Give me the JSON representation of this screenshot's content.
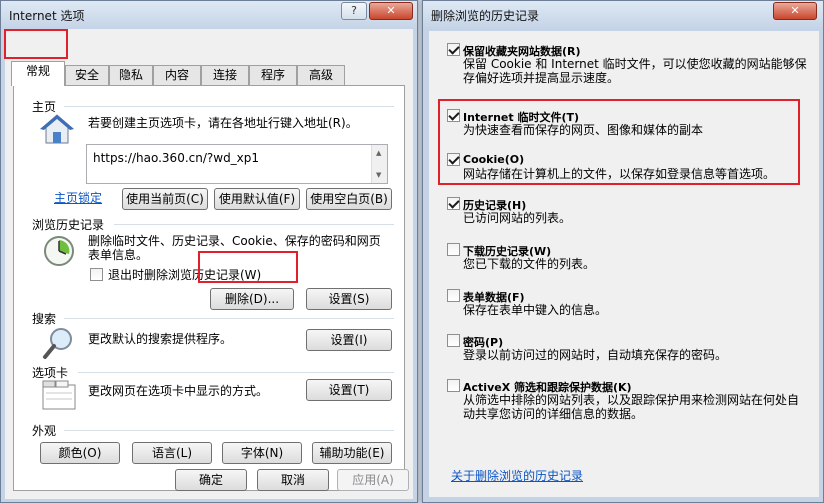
{
  "left_window": {
    "title": "Internet 选项",
    "help_btn": "?",
    "close_btn": "✕",
    "tabs": [
      "常规",
      "安全",
      "隐私",
      "内容",
      "连接",
      "程序",
      "高级"
    ],
    "home": {
      "group": "主页",
      "desc": "若要创建主页选项卡，请在各地址行键入地址(R)。",
      "url": "https://hao.360.cn/?wd_xp1",
      "lock_link": "主页锁定",
      "btn_current": "使用当前页(C)",
      "btn_default": "使用默认值(F)",
      "btn_blank": "使用空白页(B)"
    },
    "history": {
      "group": "浏览历史记录",
      "desc_line1": "删除临时文件、历史记录、Cookie、保存的密码和网页",
      "desc_line2": "表单信息。",
      "checkbox_label": "退出时删除浏览历史记录(W)",
      "btn_delete": "删除(D)...",
      "btn_settings": "设置(S)"
    },
    "search": {
      "group": "搜索",
      "desc": "更改默认的搜索提供程序。",
      "btn": "设置(I)"
    },
    "tabs_group": {
      "group": "选项卡",
      "desc": "更改网页在选项卡中显示的方式。",
      "btn": "设置(T)"
    },
    "appearance": {
      "group": "外观",
      "btn_colors": "颜色(O)",
      "btn_languages": "语言(L)",
      "btn_fonts": "字体(N)",
      "btn_access": "辅助功能(E)"
    },
    "footer": {
      "ok": "确定",
      "cancel": "取消",
      "apply": "应用(A)"
    }
  },
  "right_window": {
    "title": "删除浏览的历史记录",
    "close_btn": "✕",
    "items": [
      {
        "label": "保留收藏夹网站数据(R)",
        "desc1": "保留 Cookie 和 Internet 临时文件，可以使您收藏的网站能够保",
        "desc2": "存偏好选项并提高显示速度。",
        "checked": true
      },
      {
        "label": "Internet 临时文件(T)",
        "desc1": "为快速查看而保存的网页、图像和媒体的副本",
        "desc2": "",
        "checked": true
      },
      {
        "label": "Cookie(O)",
        "desc1": "网站存储在计算机上的文件，以保存如登录信息等首选项。",
        "desc2": "",
        "checked": true
      },
      {
        "label": "历史记录(H)",
        "desc1": "已访问网站的列表。",
        "desc2": "",
        "checked": true
      },
      {
        "label": "下载历史记录(W)",
        "desc1": "您已下载的文件的列表。",
        "desc2": "",
        "checked": false
      },
      {
        "label": "表单数据(F)",
        "desc1": "保存在表单中键入的信息。",
        "desc2": "",
        "checked": false
      },
      {
        "label": "密码(P)",
        "desc1": "登录以前访问过的网站时，自动填充保存的密码。",
        "desc2": "",
        "checked": false
      },
      {
        "label": "ActiveX 筛选和跟踪保护数据(K)",
        "desc1": "从筛选中排除的网站列表，以及跟踪保护用来检测网站在何处自",
        "desc2": "动共享您访问的详细信息的数据。",
        "checked": false
      }
    ],
    "about_link": "关于删除浏览的历史记录"
  },
  "colors": {
    "highlight": "#e0202a",
    "link": "#0b55c4"
  }
}
